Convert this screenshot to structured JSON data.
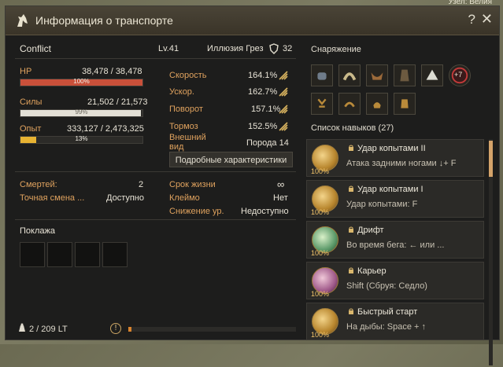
{
  "background": {
    "corner_text": "Узел: Велия"
  },
  "window": {
    "title": "Информация о транспорте"
  },
  "vehicle": {
    "name": "Conflict",
    "level": "Lv.41",
    "breed_name": "Иллюзия Грез",
    "shield_value": "32"
  },
  "bars": {
    "hp": {
      "label": "HP",
      "value": "38,478 / 38,478",
      "percent_text": "100%",
      "percent": 100,
      "color": "#c9503a"
    },
    "stamina": {
      "label": "Силы",
      "value": "21,502 / 21,573",
      "percent_text": "99%",
      "percent": 99,
      "color": "#e3e0d6"
    },
    "exp": {
      "label": "Опыт",
      "value": "333,127 / 2,473,325",
      "percent_text": "13%",
      "percent": 13,
      "color": "#e8b332"
    }
  },
  "stats": {
    "speed": {
      "label": "Скорость",
      "value": "164.1%"
    },
    "accel": {
      "label": "Ускор.",
      "value": "162.7%"
    },
    "turn": {
      "label": "Поворот",
      "value": "157.1%"
    },
    "brake": {
      "label": "Тормоз",
      "value": "152.5%"
    },
    "appearance": {
      "label": "Внешний вид",
      "value": "Порода 14"
    }
  },
  "detail_button": "Подробные характеристики",
  "info": {
    "deaths": {
      "label": "Смертей:",
      "value": "2"
    },
    "exact_change": {
      "label": "Точная смена ...",
      "value": "Доступно"
    },
    "lifespan": {
      "label": "Срок жизни",
      "value": "∞"
    },
    "brand": {
      "label": "Клеймо",
      "value": "Нет"
    },
    "level_decrease": {
      "label": "Снижение ур.",
      "value": "Недоступно"
    }
  },
  "cargo": {
    "title": "Поклажа"
  },
  "weight": {
    "text": "2 / 209 LT"
  },
  "equipment": {
    "title": "Снаряжение",
    "enhance_badge": "+7"
  },
  "skills": {
    "title": "Список навыков (27)",
    "items": [
      {
        "name": "Удар копытами II",
        "desc": "Атака задними ногами ↓+ F",
        "pct": "100%"
      },
      {
        "name": "Удар копытами I",
        "desc": "Удар копытами: F",
        "pct": "100%"
      },
      {
        "name": "Дрифт",
        "desc": "Во время бега:  ←  или ...",
        "pct": "100%"
      },
      {
        "name": "Карьер",
        "desc": "Shift (Сбруя: Седло)",
        "pct": "100%"
      },
      {
        "name": "Быстрый старт",
        "desc": "На дыбы: Space +  ↑",
        "pct": "100%"
      }
    ]
  },
  "help": "?",
  "close": "✕"
}
